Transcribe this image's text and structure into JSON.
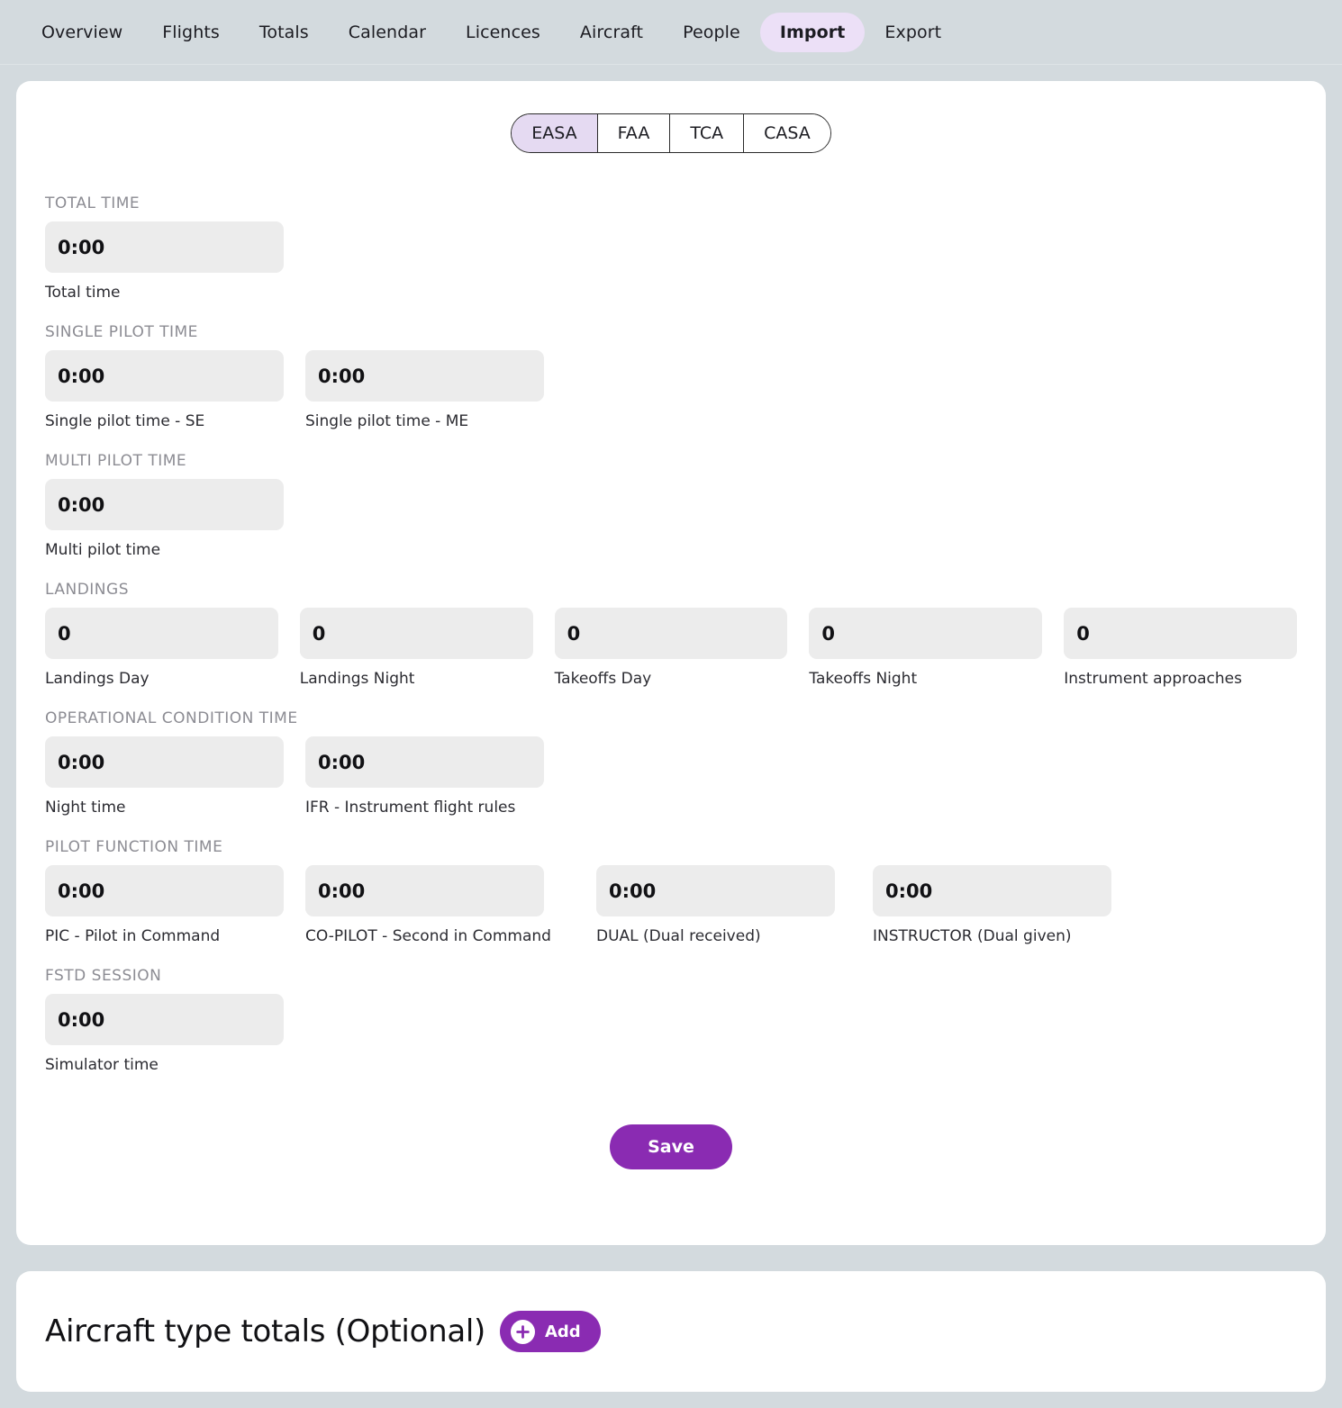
{
  "nav": {
    "items": [
      {
        "label": "Overview",
        "active": false
      },
      {
        "label": "Flights",
        "active": false
      },
      {
        "label": "Totals",
        "active": false
      },
      {
        "label": "Calendar",
        "active": false
      },
      {
        "label": "Licences",
        "active": false
      },
      {
        "label": "Aircraft",
        "active": false
      },
      {
        "label": "People",
        "active": false
      },
      {
        "label": "Import",
        "active": true
      },
      {
        "label": "Export",
        "active": false
      }
    ]
  },
  "standard_selector": {
    "options": [
      "EASA",
      "FAA",
      "TCA",
      "CASA"
    ],
    "selected": "EASA"
  },
  "form": {
    "sections": [
      {
        "title": "TOTAL TIME",
        "fields": [
          {
            "value": "0:00",
            "label": "Total time",
            "width": "w-std"
          }
        ]
      },
      {
        "title": "SINGLE PILOT TIME",
        "fields": [
          {
            "value": "0:00",
            "label": "Single pilot time - SE",
            "width": "w-std"
          },
          {
            "value": "0:00",
            "label": "Single pilot time - ME",
            "width": "w-std"
          }
        ]
      },
      {
        "title": "MULTI PILOT TIME",
        "fields": [
          {
            "value": "0:00",
            "label": "Multi pilot time",
            "width": "w-std"
          }
        ]
      },
      {
        "title": "LANDINGS",
        "fields": [
          {
            "value": "0",
            "label": "Landings Day",
            "width": "w-std"
          },
          {
            "value": "0",
            "label": "Landings Night",
            "width": "w-std"
          },
          {
            "value": "0",
            "label": "Takeoffs Day",
            "width": "w-std"
          },
          {
            "value": "0",
            "label": "Takeoffs Night",
            "width": "w-std"
          },
          {
            "value": "0",
            "label": "Instrument approaches",
            "width": "w-std"
          }
        ]
      },
      {
        "title": "OPERATIONAL CONDITION TIME",
        "fields": [
          {
            "value": "0:00",
            "label": "Night time",
            "width": "w-std"
          },
          {
            "value": "0:00",
            "label": "IFR - Instrument flight rules",
            "width": "w-std"
          }
        ]
      },
      {
        "title": "PILOT FUNCTION TIME",
        "row_class": "pf-row",
        "fields": [
          {
            "value": "0:00",
            "label": "PIC - Pilot in Command",
            "width": "w-pf1"
          },
          {
            "value": "0:00",
            "label": "CO-PILOT - Second in Command",
            "width": "w-pf2"
          },
          {
            "value": "0:00",
            "label": "DUAL (Dual received)",
            "width": "w-pf3"
          },
          {
            "value": "0:00",
            "label": "INSTRUCTOR (Dual given)",
            "width": "w-pf4"
          }
        ]
      },
      {
        "title": "FSTD SESSION",
        "fields": [
          {
            "value": "0:00",
            "label": "Simulator time",
            "width": "w-std"
          }
        ]
      }
    ],
    "save_label": "Save"
  },
  "aircraft_totals": {
    "title": "Aircraft type totals (Optional)",
    "add_label": "Add",
    "add_icon": "plus-circle-icon"
  },
  "colors": {
    "page_background": "#d3dade",
    "card_background": "#ffffff",
    "accent_purple": "#8a2bb2",
    "active_tab_background": "#ece0f7",
    "segment_active_background": "#e5daf2",
    "input_background": "#ececec",
    "section_title_color": "#8c8c93"
  }
}
